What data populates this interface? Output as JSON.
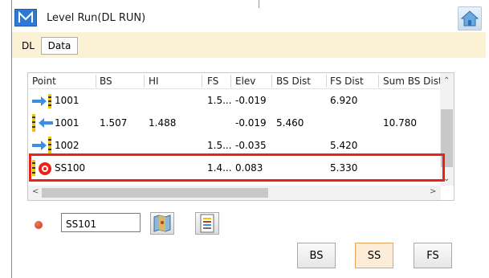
{
  "window": {
    "title": "Level Run(DL RUN)"
  },
  "icons": {
    "logo": "m-logo-icon",
    "home": "home-icon"
  },
  "tabs": [
    {
      "label": "DL",
      "active": true
    },
    {
      "label": "Data",
      "active": false
    }
  ],
  "table": {
    "columns": [
      "Point",
      "BS",
      "HI",
      "FS",
      "Elev",
      "BS Dist",
      "FS Dist",
      "Sum BS Dist"
    ],
    "rows": [
      {
        "icon": "foresight-arrow-icon",
        "point": "1001",
        "bs": "",
        "hi": "",
        "fs": "1.5...",
        "elev": "-0.019",
        "bs_dist": "",
        "fs_dist": "6.920",
        "sum_bs_dist": ""
      },
      {
        "icon": "backsight-arrow-icon",
        "point": "1001",
        "bs": "1.507",
        "hi": "1.488",
        "fs": "",
        "elev": "-0.019",
        "bs_dist": "5.460",
        "fs_dist": "",
        "sum_bs_dist": "10.780"
      },
      {
        "icon": "foresight-arrow-icon",
        "point": "1002",
        "bs": "",
        "hi": "",
        "fs": "1.5...",
        "elev": "-0.035",
        "bs_dist": "",
        "fs_dist": "5.420",
        "sum_bs_dist": ""
      },
      {
        "icon": "sideshot-target-icon",
        "point": "SS100",
        "bs": "",
        "hi": "",
        "fs": "1.4...",
        "elev": "0.083",
        "bs_dist": "",
        "fs_dist": "5.330",
        "sum_bs_dist": "",
        "highlighted": true
      }
    ]
  },
  "point_input": {
    "value": "SS101"
  },
  "buttons": {
    "bs": "BS",
    "ss": "SS",
    "fs": "FS",
    "active": "SS"
  },
  "colors": {
    "accent": "#2c7ad6",
    "highlight": "#e8211b",
    "tab_strip": "#fbf2d5",
    "active_button": "#fcecd8"
  }
}
